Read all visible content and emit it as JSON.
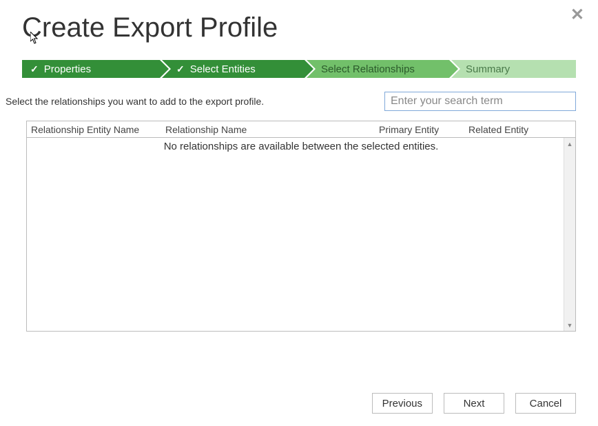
{
  "title": "Create Export Profile",
  "close_label": "✕",
  "steps": {
    "properties": "Properties",
    "select_entities": "Select Entities",
    "select_relationships": "Select Relationships",
    "summary": "Summary",
    "checkmark": "✓"
  },
  "instruction": "Select the relationships you want to add to the export profile.",
  "search_placeholder": "Enter your search term",
  "table": {
    "headers": {
      "entity_name": "Relationship Entity Name",
      "relationship_name": "Relationship Name",
      "primary_entity": "Primary Entity",
      "related_entity": "Related Entity"
    },
    "empty_message": "No relationships are available between the selected entities."
  },
  "buttons": {
    "previous": "Previous",
    "next": "Next",
    "cancel": "Cancel"
  }
}
